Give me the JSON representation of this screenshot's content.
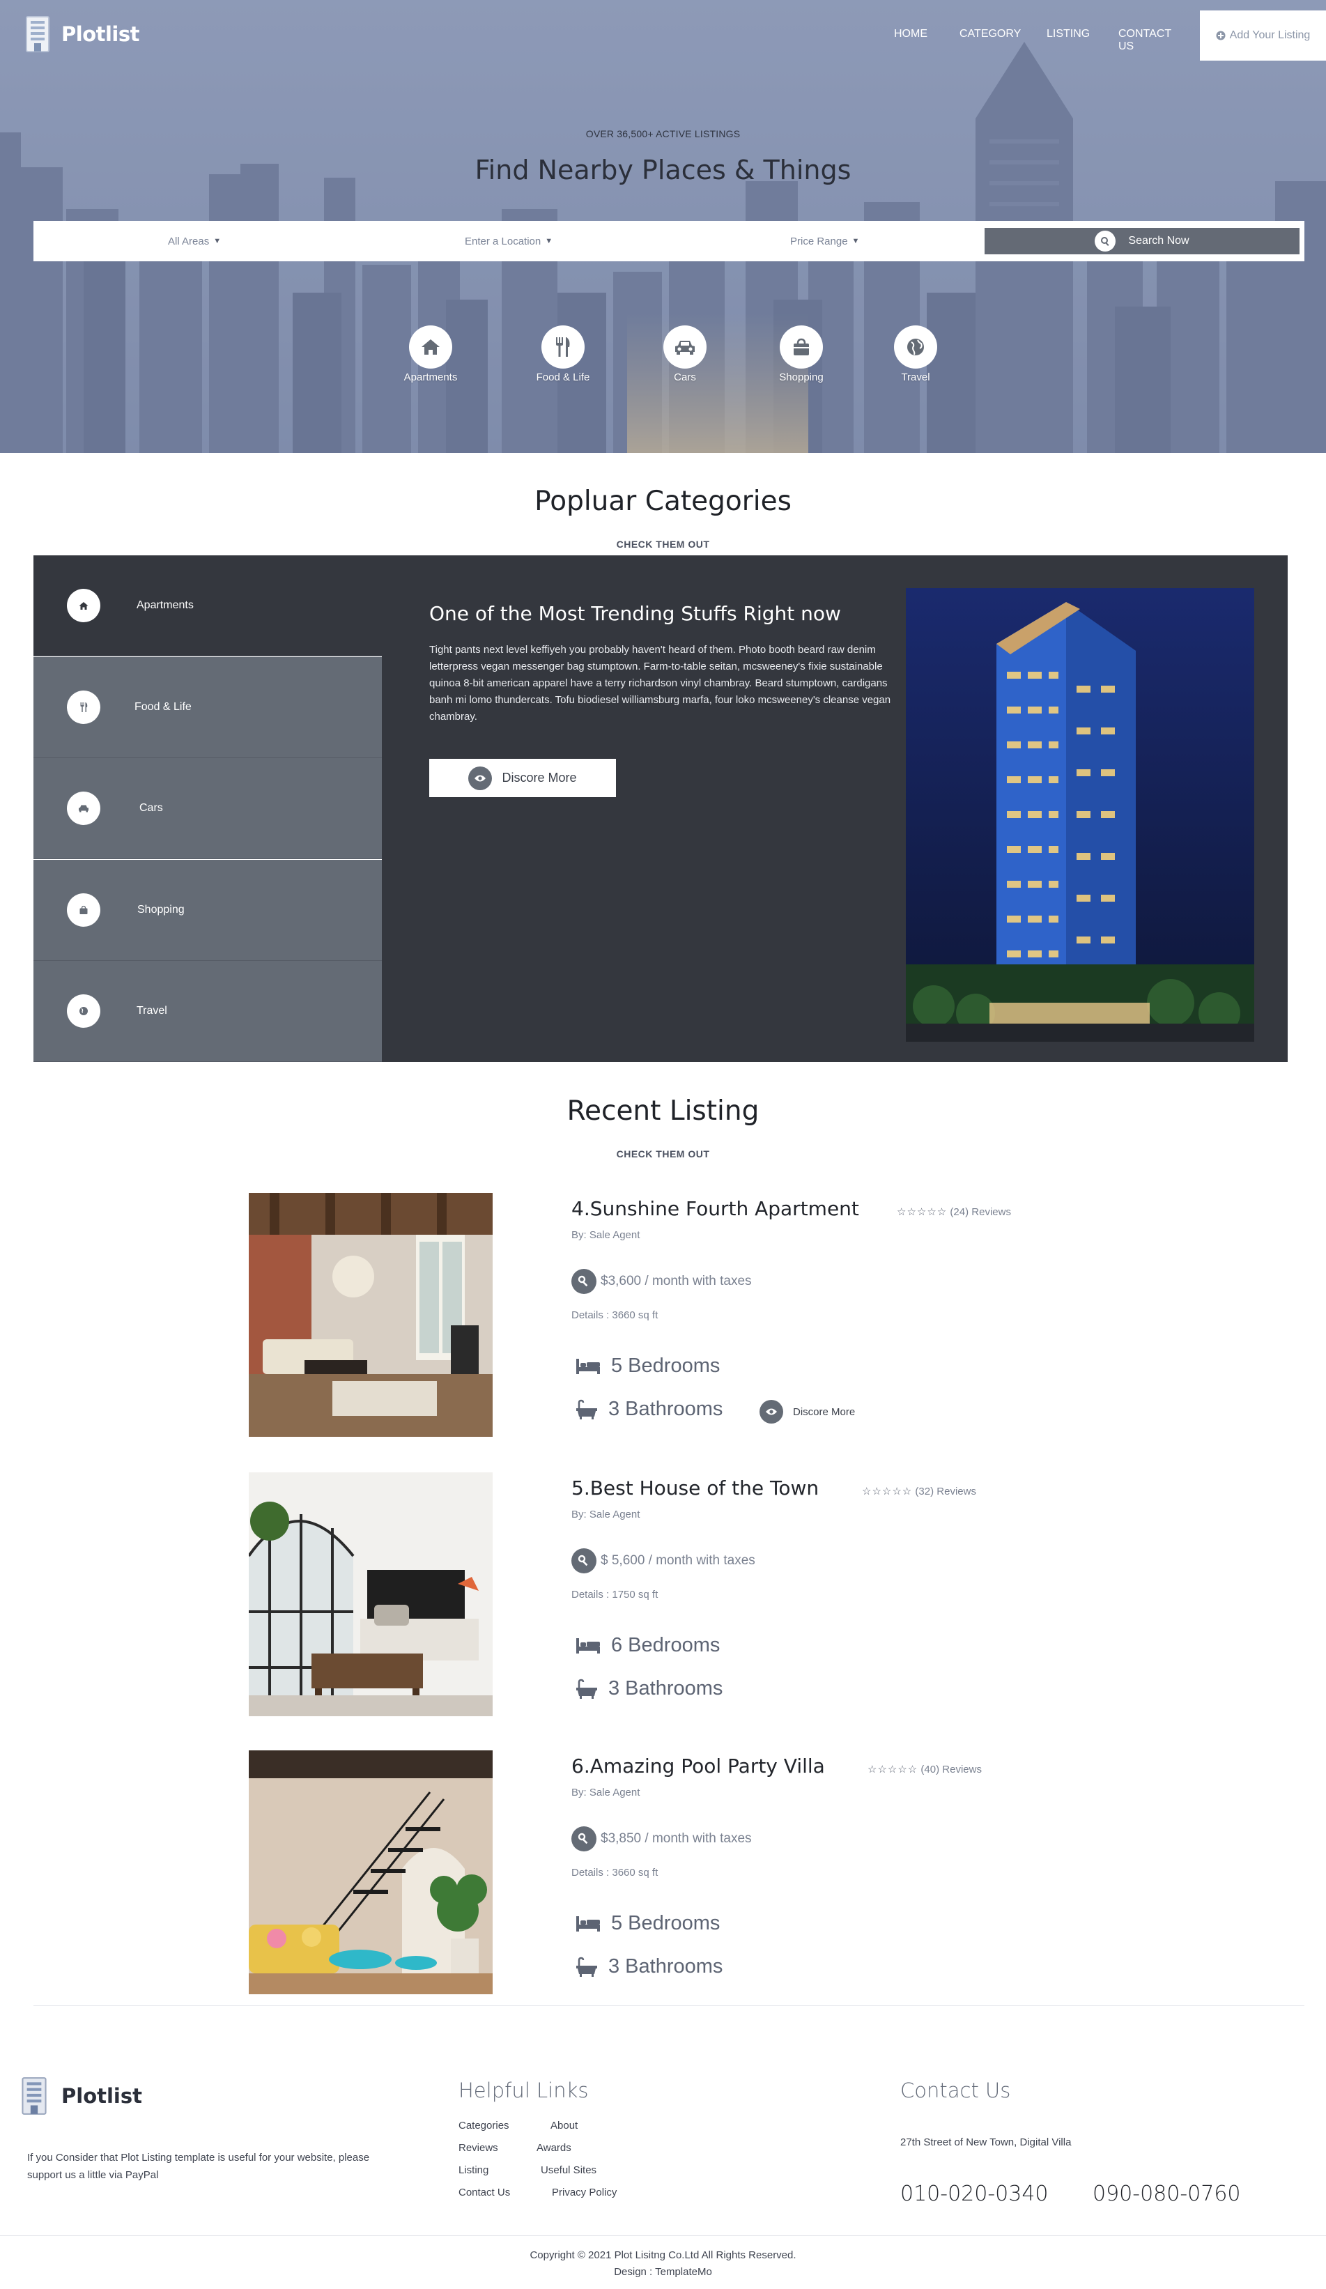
{
  "brand": {
    "name": "Plotlist"
  },
  "nav": {
    "items": [
      "HOME",
      "CATEGORY",
      "LISTING",
      "CONTACT US"
    ],
    "add_listing": "Add Your Listing"
  },
  "hero": {
    "kicker": "OVER 36,500+ ACTIVE LISTINGS",
    "title": "Find Nearby Places & Things",
    "search": {
      "area": "All Areas",
      "location": "Enter a Location",
      "price": "Price Range",
      "button": "Search Now"
    },
    "categories": [
      {
        "label": "Apartments",
        "icon": "home-icon"
      },
      {
        "label": "Food & Life",
        "icon": "utensils-icon"
      },
      {
        "label": "Cars",
        "icon": "car-icon"
      },
      {
        "label": "Shopping",
        "icon": "shopping-bag-icon"
      },
      {
        "label": "Travel",
        "icon": "globe-icon"
      }
    ]
  },
  "popular": {
    "title": "Popluar Categories",
    "subtitle": "CHECK THEM OUT",
    "tabs": [
      {
        "label": "Apartments",
        "icon": "home-icon",
        "active": true
      },
      {
        "label": "Food & Life",
        "icon": "utensils-icon",
        "active": false
      },
      {
        "label": "Cars",
        "icon": "car-icon",
        "active": false
      },
      {
        "label": "Shopping",
        "icon": "shopping-bag-icon",
        "active": false
      },
      {
        "label": "Travel",
        "icon": "globe-icon",
        "active": false
      }
    ],
    "panel": {
      "heading": "One of the Most Trending Stuffs Right now",
      "text": "Tight pants next level keffiyeh you probably haven't heard of them. Photo booth beard raw denim letterpress vegan messenger bag stumptown. Farm-to-table seitan, mcsweeney's fixie sustainable quinoa 8-bit american apparel have a terry richardson vinyl chambray. Beard stumptown, cardigans banh mi lomo thundercats. Tofu biodiesel williamsburg marfa, four loko mcsweeney's cleanse vegan chambray.",
      "button": "Discore More"
    }
  },
  "recent": {
    "title": "Recent Listing",
    "subtitle": "CHECK THEM OUT",
    "items": [
      {
        "title": "4.Sunshine Fourth Apartment",
        "reviews": "(24) Reviews",
        "by": "By: Sale Agent",
        "price": "$3,600 / month with taxes",
        "details": "Details : 3660 sq ft",
        "bedrooms": "5 Bedrooms",
        "bathrooms": "3 Bathrooms",
        "more": "Discore More"
      },
      {
        "title": "5.Best House of the Town",
        "reviews": "(32) Reviews",
        "by": "By: Sale Agent",
        "price": "$ 5,600 / month with taxes",
        "details": "Details : 1750 sq ft",
        "bedrooms": "6 Bedrooms",
        "bathrooms": "3 Bathrooms"
      },
      {
        "title": "6.Amazing Pool Party Villa",
        "reviews": "(40) Reviews",
        "by": "By: Sale Agent",
        "price": "$3,850 / month with taxes",
        "details": "Details : 3660 sq ft",
        "bedrooms": "5 Bedrooms",
        "bathrooms": "3 Bathrooms"
      }
    ]
  },
  "footer": {
    "brand": "Plotlist",
    "note": "If you Consider that Plot Listing template is useful for your website, please support us a little via PayPal",
    "links_title": "Helpful Links",
    "links": [
      "Categories",
      "About",
      "Reviews",
      "Awards",
      "Listing",
      "Useful Sites",
      "Contact Us",
      "Privacy Policy"
    ],
    "contact_title": "Contact Us",
    "address": "27th Street of New Town, Digital Villa",
    "phone1": "010-020-0340",
    "phone2": "090-080-0760",
    "copyright": "Copyright © 2021 Plot Lisitng Co.Ltd All Rights Reserved.",
    "design": "Design : TemplateMo"
  },
  "colors": {
    "accent": "#646b75",
    "dark": "#34373e",
    "hero": "#8793b0"
  }
}
